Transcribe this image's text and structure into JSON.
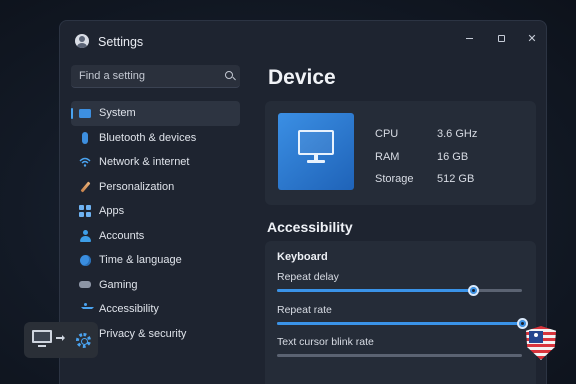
{
  "window": {
    "title": "Settings",
    "controls": {
      "minimize": "minimize",
      "maximize": "maximize",
      "close": "✕"
    }
  },
  "search": {
    "placeholder": "Find a setting",
    "value": ""
  },
  "sidebar": {
    "items": [
      {
        "label": "System",
        "icon": "monitor-icon",
        "active": true
      },
      {
        "label": "Bluetooth & devices",
        "icon": "bluetooth-icon"
      },
      {
        "label": "Network & internet",
        "icon": "wifi-icon"
      },
      {
        "label": "Personalization",
        "icon": "brush-icon"
      },
      {
        "label": "Apps",
        "icon": "apps-grid-icon"
      },
      {
        "label": "Accounts",
        "icon": "person-icon"
      },
      {
        "label": "Time & language",
        "icon": "globe-clock-icon"
      },
      {
        "label": "Gaming",
        "icon": "gamepad-icon"
      },
      {
        "label": "Accessibility",
        "icon": "accessibility-icon"
      },
      {
        "label": "Privacy & security",
        "icon": "shield-icon"
      }
    ]
  },
  "main": {
    "title": "Device",
    "device": {
      "specs": [
        {
          "label": "CPU",
          "value": "3.6 GHz"
        },
        {
          "label": "RAM",
          "value": "16 GB"
        },
        {
          "label": "Storage",
          "value": "512 GB"
        }
      ]
    },
    "accessibility": {
      "title": "Accessibility",
      "group": "Keyboard",
      "sliders": [
        {
          "label": "Repeat delay",
          "level": 0.8
        },
        {
          "label": "Repeat rate",
          "level": 1.0
        },
        {
          "label": "Text cursor blink rate",
          "level": 0.0
        }
      ]
    }
  },
  "colors": {
    "accent": "#3a93e8",
    "window_bg": "#1e2430",
    "card_bg": "#252c38"
  }
}
